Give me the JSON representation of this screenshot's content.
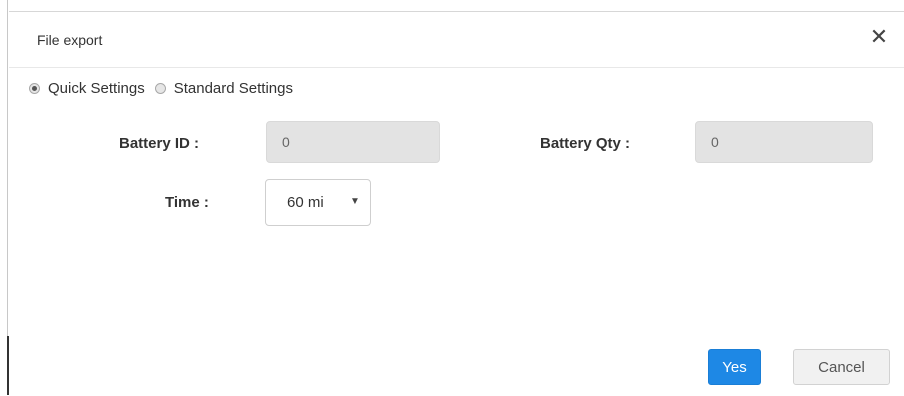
{
  "dialog": {
    "title": "File export",
    "close_icon": "close-icon"
  },
  "settings_mode": {
    "options": [
      {
        "label": "Quick Settings",
        "checked": true
      },
      {
        "label": "Standard Settings",
        "checked": false
      }
    ]
  },
  "form": {
    "battery_id": {
      "label": "Battery ID :",
      "value": "0"
    },
    "battery_qty": {
      "label": "Battery Qty :",
      "value": "0"
    },
    "time": {
      "label": "Time :",
      "selected": "60 mi"
    }
  },
  "footer": {
    "yes_label": "Yes",
    "cancel_label": "Cancel"
  },
  "colors": {
    "accent": "#1e88e5",
    "input_disabled_bg": "#e3e3e3"
  }
}
